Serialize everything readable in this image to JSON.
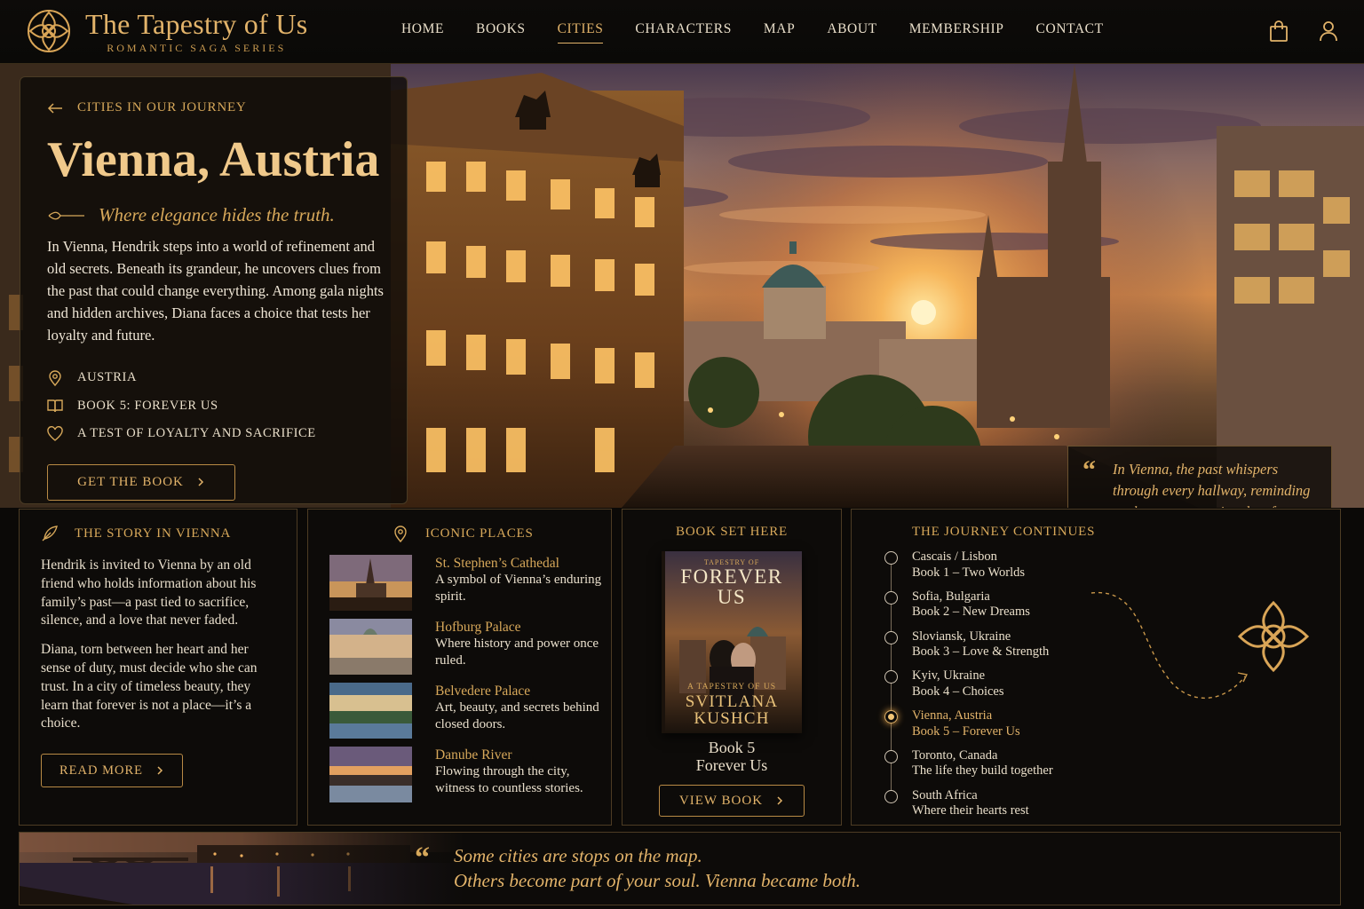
{
  "brand": {
    "title": "The Tapestry of Us",
    "subtitle": "ROMANTIC SAGA SERIES"
  },
  "nav": {
    "items": [
      {
        "label": "HOME"
      },
      {
        "label": "BOOKS"
      },
      {
        "label": "CITIES",
        "active": true
      },
      {
        "label": "CHARACTERS"
      },
      {
        "label": "MAP"
      },
      {
        "label": "ABOUT"
      },
      {
        "label": "MEMBERSHIP"
      },
      {
        "label": "CONTACT"
      }
    ],
    "icons": [
      "shopping-bag-icon",
      "user-icon"
    ]
  },
  "intro": {
    "back_label": "CITIES IN OUR JOURNEY",
    "city": "Vienna, Austria",
    "tagline": "Where elegance hides the truth.",
    "description": "In Vienna, Hendrik steps into a world of refinement and old secrets. Beneath its grandeur, he uncovers clues from the past that could change everything. Among gala nights and hidden archives, Diana faces a choice that tests her loyalty and future.",
    "facts": [
      {
        "icon": "map-pin-icon",
        "label": "AUSTRIA"
      },
      {
        "icon": "open-book-icon",
        "label": "BOOK 5: FOREVER US"
      },
      {
        "icon": "heart-icon",
        "label": "A TEST OF LOYALTY AND SACRIFICE"
      }
    ],
    "cta": "GET THE BOOK"
  },
  "hero_quote": "In Vienna, the past whispers through every hallway, reminding us that some promises last forever.",
  "story": {
    "heading": "THE STORY IN VIENNA",
    "paragraphs": [
      "Hendrik is invited to Vienna by an old friend who holds information about his family’s past—a past tied to sacrifice, silence, and a love that never faded.",
      "Diana, torn between her heart and her sense of duty, must decide who she can trust. In a city of timeless beauty, they learn that forever is not a place—it’s a choice."
    ],
    "cta": "READ MORE"
  },
  "places": {
    "heading": "ICONIC PLACES",
    "items": [
      {
        "name": "St. Stephen’s Cathedal",
        "desc": "A symbol of Vienna’s enduring spirit."
      },
      {
        "name": "Hofburg Palace",
        "desc": "Where history and power once ruled."
      },
      {
        "name": "Belvedere Palace",
        "desc": "Art, beauty, and secrets behind closed doors."
      },
      {
        "name": "Danube River",
        "desc": "Flowing through the city, witness to countless stories."
      }
    ]
  },
  "book": {
    "heading": "BOOK SET HERE",
    "cover_series_top": "TAPESTRY OF",
    "cover_title_1": "FOREVER",
    "cover_title_2": "US",
    "cover_series": "A TAPESTRY OF US",
    "cover_author_1": "SVITLANA",
    "cover_author_2": "KUSHCH",
    "caption_1": "Book 5",
    "caption_2": "Forever Us",
    "cta": "VIEW BOOK"
  },
  "journey": {
    "heading": "THE JOURNEY CONTINUES",
    "items": [
      {
        "city": "Cascais / Lisbon",
        "book": "Book 1 – Two Worlds"
      },
      {
        "city": "Sofia, Bulgaria",
        "book": "Book 2 – New Dreams"
      },
      {
        "city": "Sloviansk, Ukraine",
        "book": "Book 3 – Love & Strength"
      },
      {
        "city": "Kyiv, Ukraine",
        "book": "Book 4 – Choices"
      },
      {
        "city": "Vienna, Austria",
        "book": "Book 5 – Forever Us",
        "current": true
      },
      {
        "city": "Toronto, Canada",
        "book": "The life they build together"
      },
      {
        "city": "South Africa",
        "book": "Where their hearts rest"
      }
    ]
  },
  "banner": {
    "line1": "Some cities are stops on the map.",
    "line2": "Others become part of your soul. Vienna became both."
  },
  "colors": {
    "accent_gold": "#d7a85a",
    "background": "#0b0907",
    "text": "#e9dfcc"
  }
}
